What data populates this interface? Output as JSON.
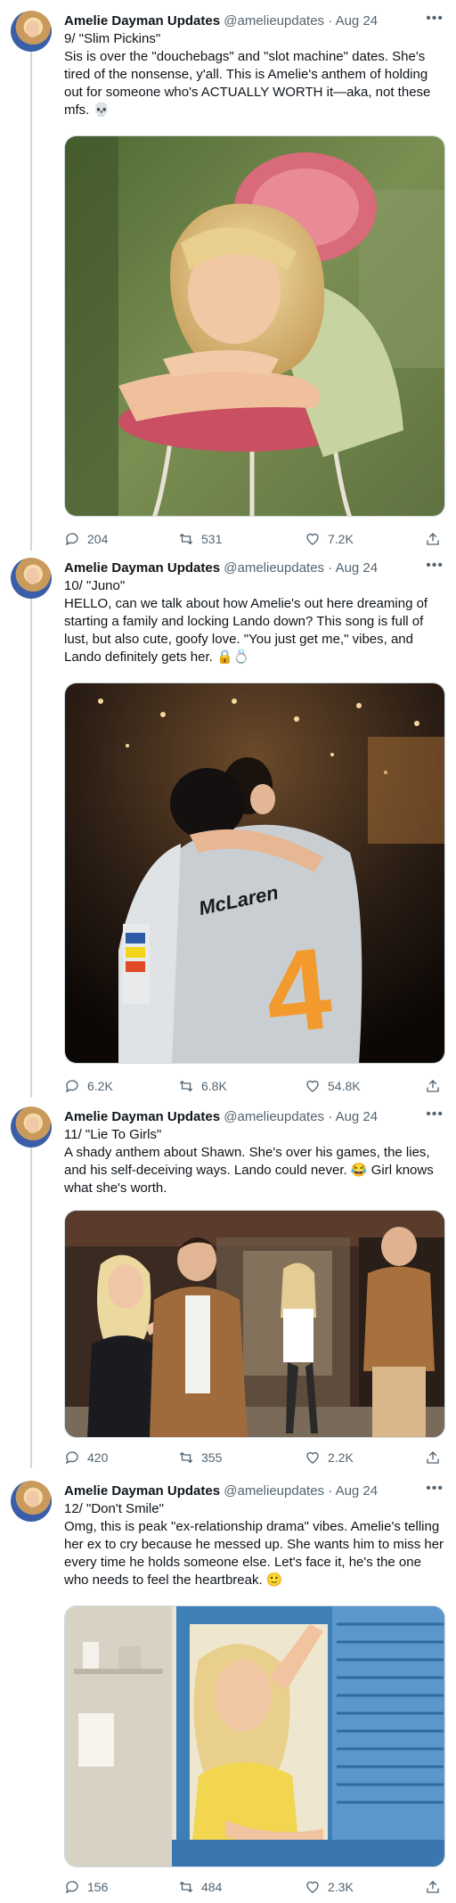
{
  "tweets": [
    {
      "name": "Amelie Dayman Updates",
      "handle": "@amelieupdates",
      "date": "Aug 24",
      "more": "•••",
      "lines": [
        "9/ \"Slim Pickins\"",
        "Sis is over the \"douchebags\" and \"slot machine\" dates. She's",
        "tired of the nonsense, y'all. This is Amelie's anthem of holding",
        "out for someone who's ACTUALLY WORTH it—aka, not these",
        "mfs. 💀"
      ],
      "replies": "204",
      "retweets": "531",
      "likes": "7.2K"
    },
    {
      "name": "Amelie Dayman Updates",
      "handle": "@amelieupdates",
      "date": "Aug 24",
      "more": "•••",
      "lines": [
        "10/ \"Juno\"",
        "HELLO, can we talk about how Amelie's out here dreaming of",
        "starting a family and locking Lando down? This song is full of",
        "lust, but also cute, goofy love. \"You just get me,\" vibes, and",
        "Lando definitely gets her. 🔒💍"
      ],
      "jersey_brand": "McLaren",
      "jersey_number": "4",
      "replies": "6.2K",
      "retweets": "6.8K",
      "likes": "54.8K"
    },
    {
      "name": "Amelie Dayman Updates",
      "handle": "@amelieupdates",
      "date": "Aug 24",
      "more": "•••",
      "lines": [
        "11/ \"Lie To Girls\"",
        "A shady anthem about Shawn. She's over his games, the lies,",
        "and his self-deceiving ways. Lando could never. 😂 Girl knows",
        "what she's worth."
      ],
      "replies": "420",
      "retweets": "355",
      "likes": "2.2K"
    },
    {
      "name": "Amelie Dayman Updates",
      "handle": "@amelieupdates",
      "date": "Aug 24",
      "more": "•••",
      "lines": [
        "12/ \"Don't Smile\"",
        "Omg, this is peak \"ex-relationship drama\" vibes. Amelie's telling",
        "her ex to cry because he messed up. She wants him to miss her",
        "every time he holds someone else. Let's face it, he's the one",
        "who needs to feel the heartbreak. 🙂"
      ],
      "replies": "156",
      "retweets": "484",
      "likes": "2.3K"
    }
  ],
  "colors": {
    "text": "#0f1419",
    "secondary": "#536471",
    "line": "#cfd9de"
  },
  "icons": [
    "reply-icon",
    "retweet-icon",
    "like-icon",
    "share-icon",
    "more-icon"
  ]
}
